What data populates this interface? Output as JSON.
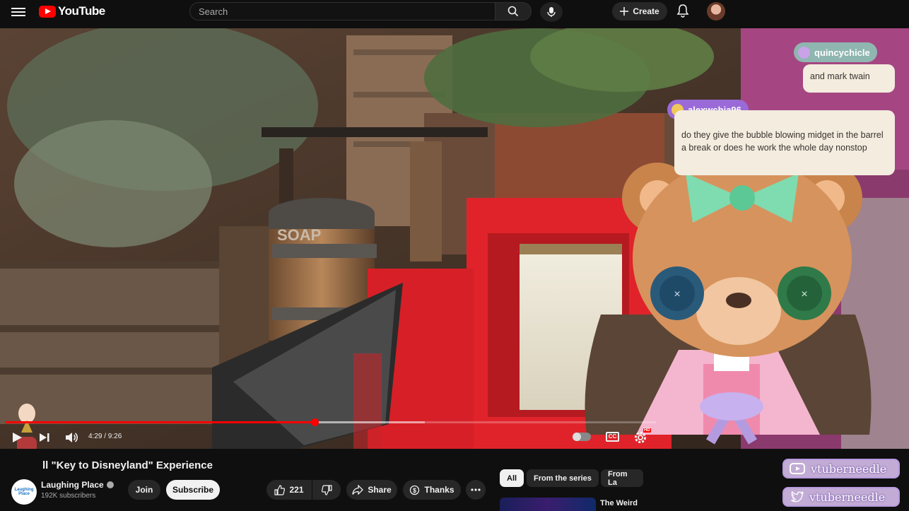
{
  "header": {
    "logo_text": "YouTube",
    "search_placeholder": "Search",
    "create_label": "Create"
  },
  "video": {
    "barrel_text": "SOAP",
    "time_display": "4:29 / 9:26",
    "progress": 0.476,
    "buffered": 0.645,
    "hd_badge": "HD"
  },
  "info": {
    "title": "ll \"Key to Disneyland\" Experience",
    "channel_name": "Laughing Place",
    "channel_avatar_text": "Laughing Place",
    "subscribers": "192K subscribers",
    "join_label": "Join",
    "subscribe_label": "Subscribe",
    "likes": "221",
    "share_label": "Share",
    "thanks_label": "Thanks"
  },
  "chips": [
    "All",
    "From the series",
    "From La"
  ],
  "recommended": {
    "title": "The Weird"
  },
  "chat": [
    {
      "user": "quincychicle",
      "message": "and mark twain",
      "color": "#8fb6b0"
    },
    {
      "user": "alexwchia96",
      "message": "do they give the bubble blowing midget in the barrel a break or does he work the whole day nonstop",
      "color": "#9a6ad8"
    }
  ],
  "socials": [
    {
      "platform": "youtube-icon",
      "handle": "vtuberneedle"
    },
    {
      "platform": "twitter-icon",
      "handle": "vtuberneedle"
    }
  ],
  "colors": {
    "accent": "#ff0000",
    "overlay_purple": "#b89be0"
  }
}
